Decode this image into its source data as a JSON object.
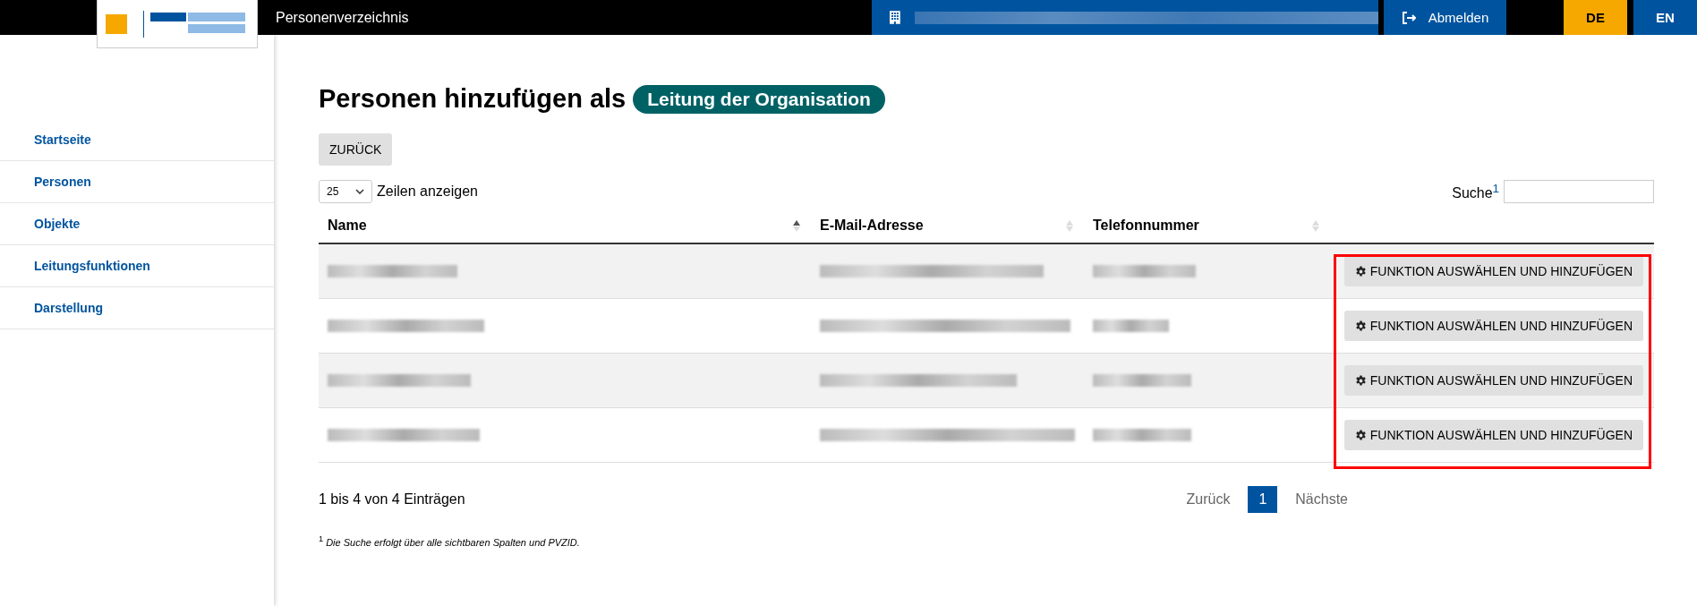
{
  "header": {
    "app_title": "Personenverzeichnis",
    "logout": "Abmelden",
    "languages": [
      {
        "label": "DE",
        "selected": true
      },
      {
        "label": "EN",
        "selected": false
      }
    ]
  },
  "sidebar": {
    "items": [
      {
        "label": "Startseite"
      },
      {
        "label": "Personen"
      },
      {
        "label": "Objekte"
      },
      {
        "label": "Leitungsfunktionen"
      },
      {
        "label": "Darstellung"
      }
    ]
  },
  "page": {
    "heading": "Personen hinzufügen als",
    "role_badge": "Leitung der Organisation",
    "back_button": "ZURÜCK"
  },
  "table": {
    "page_length": "25",
    "page_length_label": "Zeilen anzeigen",
    "search_label": "Suche$^{1}$",
    "columns": [
      {
        "label": "Name",
        "sorted": true
      },
      {
        "label": "E-Mail-Adresse",
        "sorted": false
      },
      {
        "label": "Telefonnummer",
        "sorted": false
      }
    ],
    "rows": [
      {
        "action": "FUNKTION AUSWÄHLEN UND HINZUFÜGEN"
      },
      {
        "action": "FUNKTION AUSWÄHLEN UND HINZUFÜGEN"
      },
      {
        "action": "FUNKTION AUSWÄHLEN UND HINZUFÜGEN"
      },
      {
        "action": "FUNKTION AUSWÄHLEN UND HINZUFÜGEN"
      }
    ],
    "info": "1 bis 4 von 4 Einträgen",
    "pagination": [
      {
        "label": "Zurück",
        "selected": false
      },
      {
        "label": "1",
        "selected": true
      },
      {
        "label": "Nächste",
        "selected": false
      }
    ],
    "footnote": "$^{1}$ *Die Suche erfolgt über alle sichtbaren Spalten und PVZID.*"
  }
}
